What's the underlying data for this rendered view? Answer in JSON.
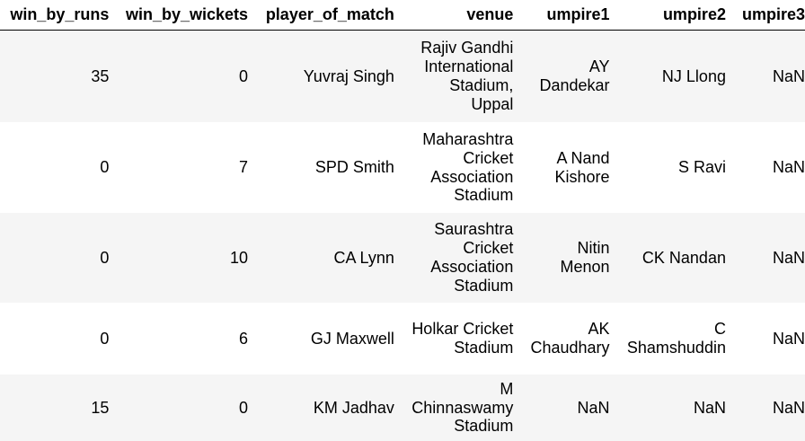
{
  "table": {
    "columns": [
      "win_by_runs",
      "win_by_wickets",
      "player_of_match",
      "venue",
      "umpire1",
      "umpire2",
      "umpire3"
    ],
    "rows": [
      {
        "win_by_runs": "35",
        "win_by_wickets": "0",
        "player_of_match": "Yuvraj Singh",
        "venue": "Rajiv Gandhi International Stadium, Uppal",
        "umpire1": "AY Dandekar",
        "umpire2": "NJ Llong",
        "umpire3": "NaN"
      },
      {
        "win_by_runs": "0",
        "win_by_wickets": "7",
        "player_of_match": "SPD Smith",
        "venue": "Maharashtra Cricket Association Stadium",
        "umpire1": "A Nand Kishore",
        "umpire2": "S Ravi",
        "umpire3": "NaN"
      },
      {
        "win_by_runs": "0",
        "win_by_wickets": "10",
        "player_of_match": "CA Lynn",
        "venue": "Saurashtra Cricket Association Stadium",
        "umpire1": "Nitin Menon",
        "umpire2": "CK Nandan",
        "umpire3": "NaN"
      },
      {
        "win_by_runs": "0",
        "win_by_wickets": "6",
        "player_of_match": "GJ Maxwell",
        "venue": "Holkar Cricket Stadium",
        "umpire1": "AK Chaudhary",
        "umpire2": "C Shamshuddin",
        "umpire3": "NaN"
      },
      {
        "win_by_runs": "15",
        "win_by_wickets": "0",
        "player_of_match": "KM Jadhav",
        "venue": "M Chinnaswamy Stadium",
        "umpire1": "NaN",
        "umpire2": "NaN",
        "umpire3": "NaN"
      }
    ]
  }
}
